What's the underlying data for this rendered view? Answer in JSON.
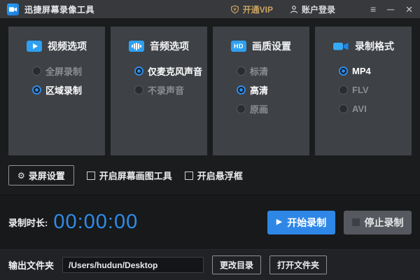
{
  "titlebar": {
    "app_title": "迅捷屏幕录像工具",
    "vip_label": "开通VIP",
    "login_label": "账户登录",
    "menu_glyph": "≡",
    "minimize_glyph": "─",
    "close_glyph": "✕"
  },
  "panels": [
    {
      "title": "视频选项",
      "icon": "play-icon",
      "options": [
        {
          "label": "全屏录制",
          "selected": false
        },
        {
          "label": "区域录制",
          "selected": true
        }
      ]
    },
    {
      "title": "音频选项",
      "icon": "audio-waveform-icon",
      "options": [
        {
          "label": "仅麦克风声音",
          "selected": true
        },
        {
          "label": "不录声音",
          "selected": false
        }
      ]
    },
    {
      "title": "画质设置",
      "icon": "hd-badge-icon",
      "icon_text": "HD",
      "options": [
        {
          "label": "标清",
          "selected": false
        },
        {
          "label": "高清",
          "selected": true
        },
        {
          "label": "原画",
          "selected": false
        }
      ]
    },
    {
      "title": "录制格式",
      "icon": "camcorder-icon",
      "options": [
        {
          "label": "MP4",
          "selected": true
        },
        {
          "label": "FLV",
          "selected": false
        },
        {
          "label": "AVI",
          "selected": false
        }
      ]
    }
  ],
  "settings_row": {
    "record_settings_label": "录屏设置",
    "gear_glyph": "⚙",
    "checkboxes": [
      {
        "label": "开启屏幕画图工具",
        "checked": false
      },
      {
        "label": "开启悬浮框",
        "checked": false
      }
    ]
  },
  "timer_row": {
    "duration_label": "录制时长:",
    "duration_value": "00:00:00",
    "start_label": "开始录制",
    "start_glyph": "▶",
    "stop_label": "停止录制"
  },
  "output_row": {
    "label": "输出文件夹",
    "path": "/Users/hudun/Desktop",
    "change_dir_label": "更改目录",
    "open_folder_label": "打开文件夹"
  },
  "colors": {
    "accent_blue": "#2e8ce8",
    "icon_blue": "#2ea0f2",
    "vip_gold": "#c9a45f",
    "panel_bg": "#3e4146"
  }
}
